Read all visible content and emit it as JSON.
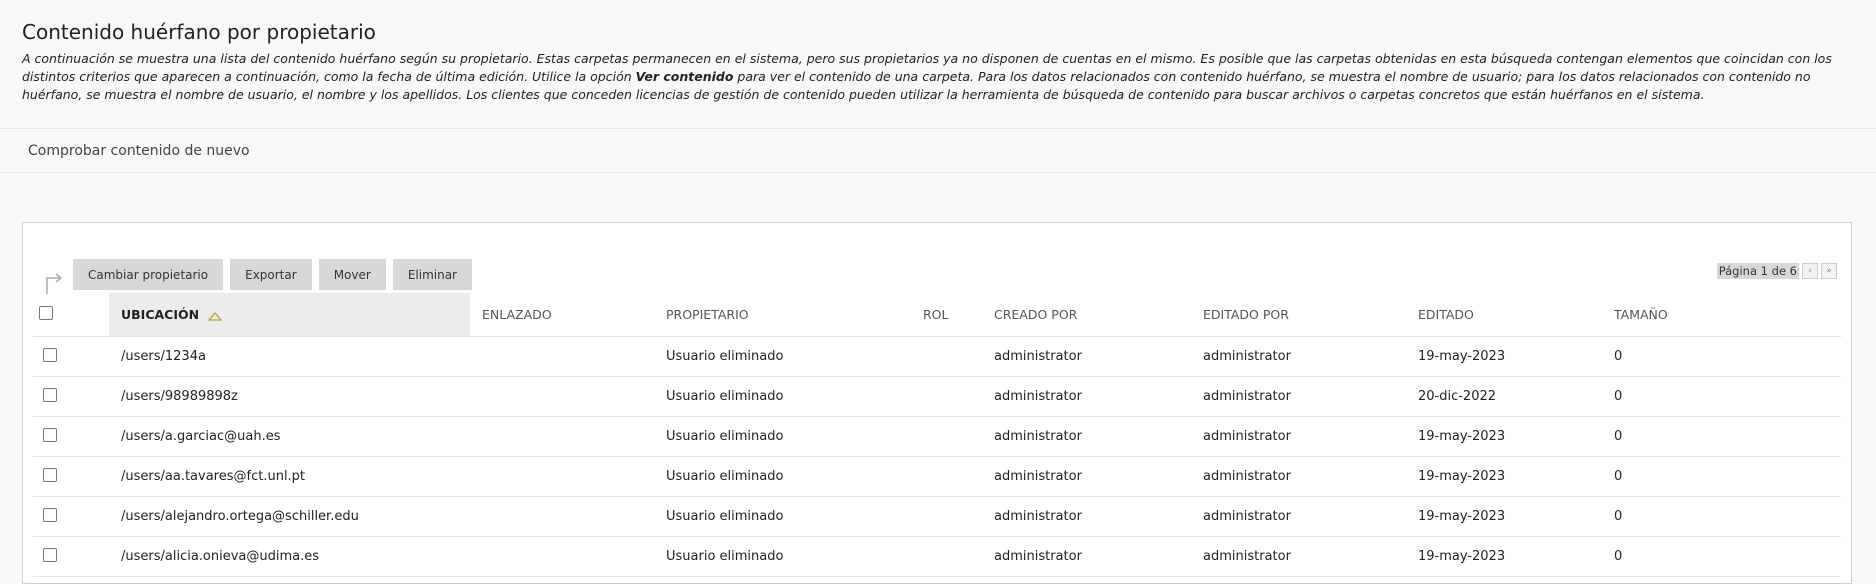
{
  "page": {
    "title": "Contenido huérfano por propietario",
    "desc_part1": "A continuación se muestra una lista del contenido huérfano según su propietario. Estas carpetas permanecen en el sistema, pero sus propietarios ya no disponen de cuentas en el mismo. Es posible que las carpetas obtenidas en esta búsqueda contengan elementos que coincidan con los distintos criterios que aparecen a continuación, como la fecha de última edición. Utilice la opción ",
    "desc_bold": "Ver contenido",
    "desc_part2": " para ver el contenido de una carpeta. Para los datos relacionados con contenido huérfano, se muestra el nombre de usuario; para los datos relacionados con contenido no huérfano, se muestra el nombre de usuario, el nombre y los apellidos. Los clientes que conceden licencias de gestión de contenido pueden utilizar la herramienta de búsqueda de contenido para buscar archivos o carpetas concretos que están huérfanos en el sistema."
  },
  "actions": {
    "recheck": "Comprobar contenido de nuevo"
  },
  "toolbar": {
    "change_owner": "Cambiar propietario",
    "export": "Exportar",
    "move": "Mover",
    "delete": "Eliminar"
  },
  "pager": {
    "label": "Página 1 de 6"
  },
  "table": {
    "headers": {
      "location": "UBICACIÓN",
      "linked": "ENLAZADO",
      "owner": "PROPIETARIO",
      "role": "ROL",
      "created_by": "CREADO POR",
      "edited_by": "EDITADO POR",
      "edited": "EDITADO",
      "size": "TAMAÑO"
    },
    "rows": [
      {
        "location": "/users/1234a",
        "linked": "",
        "owner": "Usuario eliminado",
        "role": "",
        "created_by": "administrator",
        "edited_by": "administrator",
        "edited": "19-may-2023",
        "size": "0"
      },
      {
        "location": "/users/98989898z",
        "linked": "",
        "owner": "Usuario eliminado",
        "role": "",
        "created_by": "administrator",
        "edited_by": "administrator",
        "edited": "20-dic-2022",
        "size": "0"
      },
      {
        "location": "/users/a.garciac@uah.es",
        "linked": "",
        "owner": "Usuario eliminado",
        "role": "",
        "created_by": "administrator",
        "edited_by": "administrator",
        "edited": "19-may-2023",
        "size": "0"
      },
      {
        "location": "/users/aa.tavares@fct.unl.pt",
        "linked": "",
        "owner": "Usuario eliminado",
        "role": "",
        "created_by": "administrator",
        "edited_by": "administrator",
        "edited": "19-may-2023",
        "size": "0"
      },
      {
        "location": "/users/alejandro.ortega@schiller.edu",
        "linked": "",
        "owner": "Usuario eliminado",
        "role": "",
        "created_by": "administrator",
        "edited_by": "administrator",
        "edited": "19-may-2023",
        "size": "0"
      },
      {
        "location": "/users/alicia.onieva@udima.es",
        "linked": "",
        "owner": "Usuario eliminado",
        "role": "",
        "created_by": "administrator",
        "edited_by": "administrator",
        "edited": "19-may-2023",
        "size": "0"
      }
    ]
  }
}
